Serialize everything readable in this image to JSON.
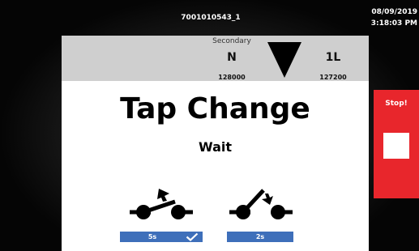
{
  "header": {
    "device_id": "7001010543_1",
    "date": "08/09/2019",
    "time": "3:18:03 PM"
  },
  "tap_indicator": {
    "label": "Secondary",
    "left_position": "N",
    "left_value": "128000",
    "right_position": "1L",
    "right_value": "127200",
    "direction_icon": "triangle-down-icon"
  },
  "main": {
    "title": "Tap Change",
    "status": "Wait"
  },
  "switches": [
    {
      "icon": "switch-opening-icon",
      "timer": "5s",
      "done": true
    },
    {
      "icon": "switch-closing-icon",
      "timer": "2s",
      "done": false
    }
  ],
  "stop_button": {
    "label": "Stop!"
  },
  "colors": {
    "accent_blue": "#3e6fba",
    "stop_red": "#e8262c",
    "tap_bar": "#cfcfcf"
  }
}
